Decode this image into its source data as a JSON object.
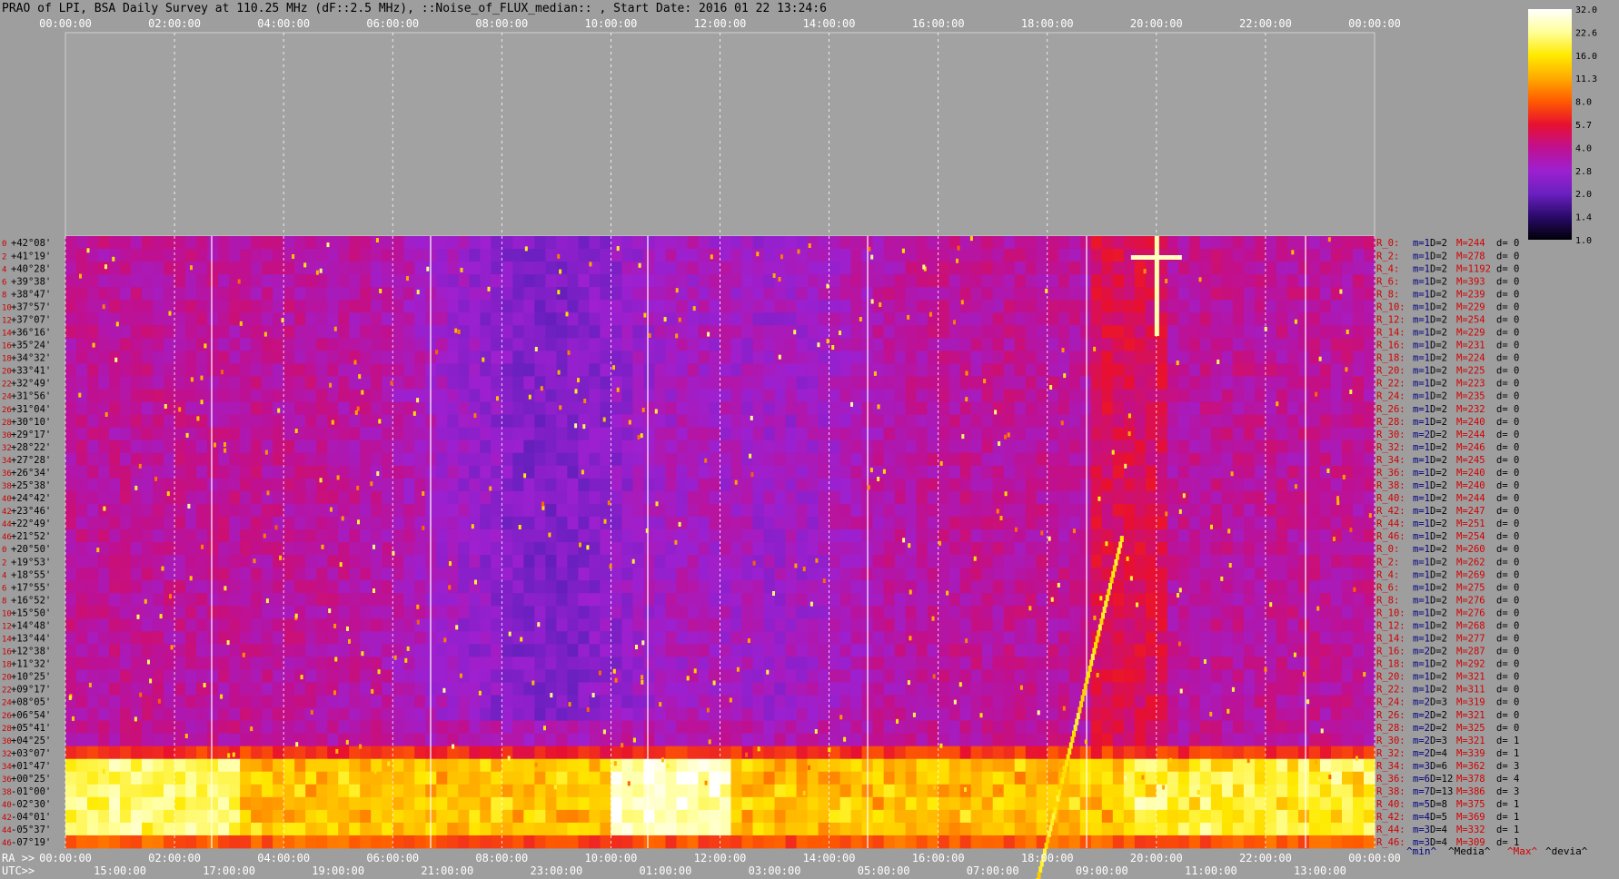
{
  "title": "PRAO of LPI, BSA Daily Survey at 110.25 MHz (dF::2.5 MHz), ::Noise_of_FLUX_median:: , Start Date: 2016 01 22 13:24:6",
  "chart_data": {
    "type": "heatmap",
    "top_time_ticks": [
      "00:00:00",
      "02:00:00",
      "04:00:00",
      "06:00:00",
      "08:00:00",
      "10:00:00",
      "12:00:00",
      "14:00:00",
      "16:00:00",
      "18:00:00",
      "20:00:00",
      "22:00:00",
      "00:00:00"
    ],
    "ra_axis_label": "RA >>",
    "ra_ticks": [
      "00:00:00",
      "02:00:00",
      "04:00:00",
      "06:00:00",
      "08:00:00",
      "10:00:00",
      "12:00:00",
      "14:00:00",
      "16:00:00",
      "18:00:00",
      "20:00:00",
      "22:00:00",
      "00:00:00"
    ],
    "utc_axis_label": "UTC>>",
    "utc_ticks": [
      "15:00:00",
      "17:00:00",
      "19:00:00",
      "21:00:00",
      "23:00:00",
      "01:00:00",
      "03:00:00",
      "05:00:00",
      "07:00:00",
      "09:00:00",
      "11:00:00",
      "13:00:00"
    ],
    "colorbar_ticks": [
      "32.0",
      "22.6",
      "16.0",
      "11.3",
      "8.0",
      "5.7",
      "4.0",
      "2.8",
      "2.0",
      "1.4",
      "1.0"
    ],
    "colorbar_colors": [
      "#ffffff",
      "#ffff99",
      "#ffea00",
      "#ffaa00",
      "#ff5a00",
      "#e81030",
      "#c01090",
      "#9d20d0",
      "#6a20c0",
      "#2a0a6a",
      "#000008"
    ],
    "row_index_labels": [
      "0",
      "2",
      "4",
      "6",
      "8",
      "10",
      "12",
      "14",
      "16",
      "18",
      "20",
      "22",
      "24",
      "26",
      "28",
      "30",
      "32",
      "34",
      "36",
      "38",
      "40",
      "42",
      "44",
      "46",
      "0",
      "2",
      "4",
      "6",
      "8",
      "10",
      "12",
      "14",
      "16",
      "18",
      "20",
      "22",
      "24",
      "26",
      "28",
      "30",
      "32",
      "34",
      "36",
      "38",
      "40",
      "42",
      "44",
      "46"
    ],
    "declinations": [
      "+42°08'",
      "+41°19'",
      "+40°28'",
      "+39°38'",
      "+38°47'",
      "+37°57'",
      "+37°07'",
      "+36°16'",
      "+35°24'",
      "+34°32'",
      "+33°41'",
      "+32°49'",
      "+31°56'",
      "+31°04'",
      "+30°10'",
      "+29°17'",
      "+28°22'",
      "+27°28'",
      "+26°34'",
      "+25°38'",
      "+24°42'",
      "+23°46'",
      "+22°49'",
      "+21°52'",
      "+20°50'",
      "+19°53'",
      "+18°55'",
      "+17°55'",
      "+16°52'",
      "+15°50'",
      "+14°48'",
      "+13°44'",
      "+12°38'",
      "+11°32'",
      "+10°25'",
      "+09°17'",
      "+08°05'",
      "+06°54'",
      "+05°41'",
      "+04°25'",
      "+03°07'",
      "+01°47'",
      "+00°25'",
      "-01°00'",
      "-02°30'",
      "-04°01'",
      "-05°37'",
      "-07°19'"
    ],
    "beam_stats": [
      {
        "r": "R_0:",
        "m": "m=1",
        "d": "D=2",
        "M": "M=244",
        "dv": "d= 0"
      },
      {
        "r": "R_2:",
        "m": "m=1",
        "d": "D=2",
        "M": "M=278",
        "dv": "d= 0"
      },
      {
        "r": "R_4:",
        "m": "m=1",
        "d": "D=2",
        "M": "M=1192",
        "dv": "d= 0"
      },
      {
        "r": "R_6:",
        "m": "m=1",
        "d": "D=2",
        "M": "M=393",
        "dv": "d= 0"
      },
      {
        "r": "R_8:",
        "m": "m=1",
        "d": "D=2",
        "M": "M=239",
        "dv": "d= 0"
      },
      {
        "r": "R_10:",
        "m": "m=1",
        "d": "D=2",
        "M": "M=229",
        "dv": "d= 0"
      },
      {
        "r": "R_12:",
        "m": "m=1",
        "d": "D=2",
        "M": "M=254",
        "dv": "d= 0"
      },
      {
        "r": "R_14:",
        "m": "m=1",
        "d": "D=2",
        "M": "M=229",
        "dv": "d= 0"
      },
      {
        "r": "R_16:",
        "m": "m=1",
        "d": "D=2",
        "M": "M=231",
        "dv": "d= 0"
      },
      {
        "r": "R_18:",
        "m": "m=1",
        "d": "D=2",
        "M": "M=224",
        "dv": "d= 0"
      },
      {
        "r": "R_20:",
        "m": "m=1",
        "d": "D=2",
        "M": "M=225",
        "dv": "d= 0"
      },
      {
        "r": "R_22:",
        "m": "m=1",
        "d": "D=2",
        "M": "M=223",
        "dv": "d= 0"
      },
      {
        "r": "R_24:",
        "m": "m=1",
        "d": "D=2",
        "M": "M=235",
        "dv": "d= 0"
      },
      {
        "r": "R_26:",
        "m": "m=1",
        "d": "D=2",
        "M": "M=232",
        "dv": "d= 0"
      },
      {
        "r": "R_28:",
        "m": "m=1",
        "d": "D=2",
        "M": "M=240",
        "dv": "d= 0"
      },
      {
        "r": "R_30:",
        "m": "m=2",
        "d": "D=2",
        "M": "M=244",
        "dv": "d= 0"
      },
      {
        "r": "R_32:",
        "m": "m=1",
        "d": "D=2",
        "M": "M=246",
        "dv": "d= 0"
      },
      {
        "r": "R_34:",
        "m": "m=1",
        "d": "D=2",
        "M": "M=245",
        "dv": "d= 0"
      },
      {
        "r": "R_36:",
        "m": "m=1",
        "d": "D=2",
        "M": "M=240",
        "dv": "d= 0"
      },
      {
        "r": "R_38:",
        "m": "m=1",
        "d": "D=2",
        "M": "M=240",
        "dv": "d= 0"
      },
      {
        "r": "R_40:",
        "m": "m=1",
        "d": "D=2",
        "M": "M=244",
        "dv": "d= 0"
      },
      {
        "r": "R_42:",
        "m": "m=1",
        "d": "D=2",
        "M": "M=247",
        "dv": "d= 0"
      },
      {
        "r": "R_44:",
        "m": "m=1",
        "d": "D=2",
        "M": "M=251",
        "dv": "d= 0"
      },
      {
        "r": "R_46:",
        "m": "m=1",
        "d": "D=2",
        "M": "M=254",
        "dv": "d= 0"
      },
      {
        "r": "R_0:",
        "m": "m=1",
        "d": "D=2",
        "M": "M=260",
        "dv": "d= 0"
      },
      {
        "r": "R_2:",
        "m": "m=1",
        "d": "D=2",
        "M": "M=262",
        "dv": "d= 0"
      },
      {
        "r": "R_4:",
        "m": "m=1",
        "d": "D=2",
        "M": "M=269",
        "dv": "d= 0"
      },
      {
        "r": "R_6:",
        "m": "m=1",
        "d": "D=2",
        "M": "M=275",
        "dv": "d= 0"
      },
      {
        "r": "R_8:",
        "m": "m=1",
        "d": "D=2",
        "M": "M=276",
        "dv": "d= 0"
      },
      {
        "r": "R_10:",
        "m": "m=1",
        "d": "D=2",
        "M": "M=276",
        "dv": "d= 0"
      },
      {
        "r": "R_12:",
        "m": "m=1",
        "d": "D=2",
        "M": "M=268",
        "dv": "d= 0"
      },
      {
        "r": "R_14:",
        "m": "m=1",
        "d": "D=2",
        "M": "M=277",
        "dv": "d= 0"
      },
      {
        "r": "R_16:",
        "m": "m=2",
        "d": "D=2",
        "M": "M=287",
        "dv": "d= 0"
      },
      {
        "r": "R_18:",
        "m": "m=1",
        "d": "D=2",
        "M": "M=292",
        "dv": "d= 0"
      },
      {
        "r": "R_20:",
        "m": "m=1",
        "d": "D=2",
        "M": "M=321",
        "dv": "d= 0"
      },
      {
        "r": "R_22:",
        "m": "m=1",
        "d": "D=2",
        "M": "M=311",
        "dv": "d= 0"
      },
      {
        "r": "R_24:",
        "m": "m=2",
        "d": "D=3",
        "M": "M=319",
        "dv": "d= 0"
      },
      {
        "r": "R_26:",
        "m": "m=2",
        "d": "D=2",
        "M": "M=321",
        "dv": "d= 0"
      },
      {
        "r": "R_28:",
        "m": "m=2",
        "d": "D=2",
        "M": "M=325",
        "dv": "d= 0"
      },
      {
        "r": "R_30:",
        "m": "m=2",
        "d": "D=3",
        "M": "M=321",
        "dv": "d= 1"
      },
      {
        "r": "R_32:",
        "m": "m=2",
        "d": "D=4",
        "M": "M=339",
        "dv": "d= 1"
      },
      {
        "r": "R_34:",
        "m": "m=3",
        "d": "D=6",
        "M": "M=362",
        "dv": "d= 3"
      },
      {
        "r": "R_36:",
        "m": "m=6",
        "d": "D=12",
        "M": "M=378",
        "dv": "d= 4"
      },
      {
        "r": "R_38:",
        "m": "m=7",
        "d": "D=13",
        "M": "M=386",
        "dv": "d= 3"
      },
      {
        "r": "R_40:",
        "m": "m=5",
        "d": "D=8",
        "M": "M=375",
        "dv": "d= 1"
      },
      {
        "r": "R_42:",
        "m": "m=4",
        "d": "D=5",
        "M": "M=369",
        "dv": "d= 1"
      },
      {
        "r": "R_44:",
        "m": "m=3",
        "d": "D=4",
        "M": "M=332",
        "dv": "d= 1"
      },
      {
        "r": "R_46:",
        "m": "m=3",
        "d": "D=4",
        "M": "M=309",
        "dv": "d= 1"
      }
    ],
    "legend": {
      "min": "^min^",
      "median": "^Media^",
      "max": "^Max^",
      "deviation": "^devia^"
    }
  }
}
